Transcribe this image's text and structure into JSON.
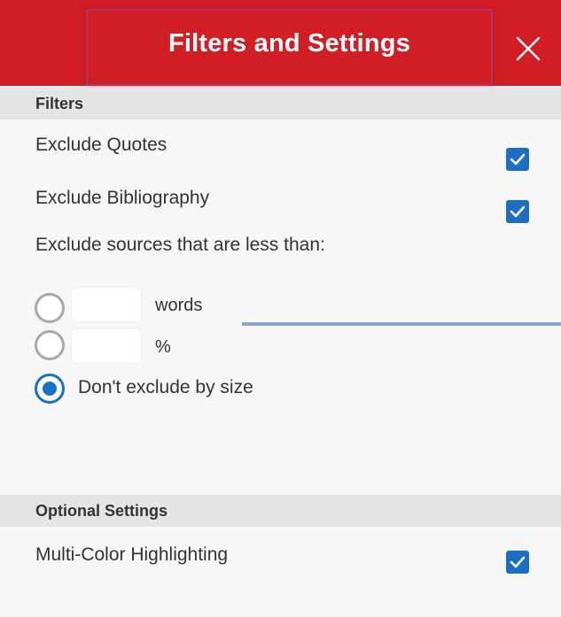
{
  "header": {
    "title": "Filters and Settings",
    "close_icon": "close-icon"
  },
  "filters": {
    "section_label": "Filters",
    "exclude_quotes": {
      "label": "Exclude Quotes",
      "checked": true
    },
    "exclude_bibliography": {
      "label": "Exclude Bibliography",
      "checked": true
    },
    "exclude_size_label": "Exclude sources that are less than:",
    "size_options": [
      {
        "unit": "words",
        "value": "",
        "selected": false
      },
      {
        "unit": "%",
        "value": "",
        "selected": false
      },
      {
        "label": "Don't exclude by size",
        "selected": true
      }
    ]
  },
  "optional": {
    "section_label": "Optional Settings",
    "multi_color": {
      "label": "Multi-Color Highlighting",
      "checked": true
    }
  },
  "colors": {
    "header_red": "#d11d23",
    "accent_blue": "#1b6ec2",
    "section_bg": "#e5e5e5",
    "panel_bg": "#f7f7f7"
  }
}
